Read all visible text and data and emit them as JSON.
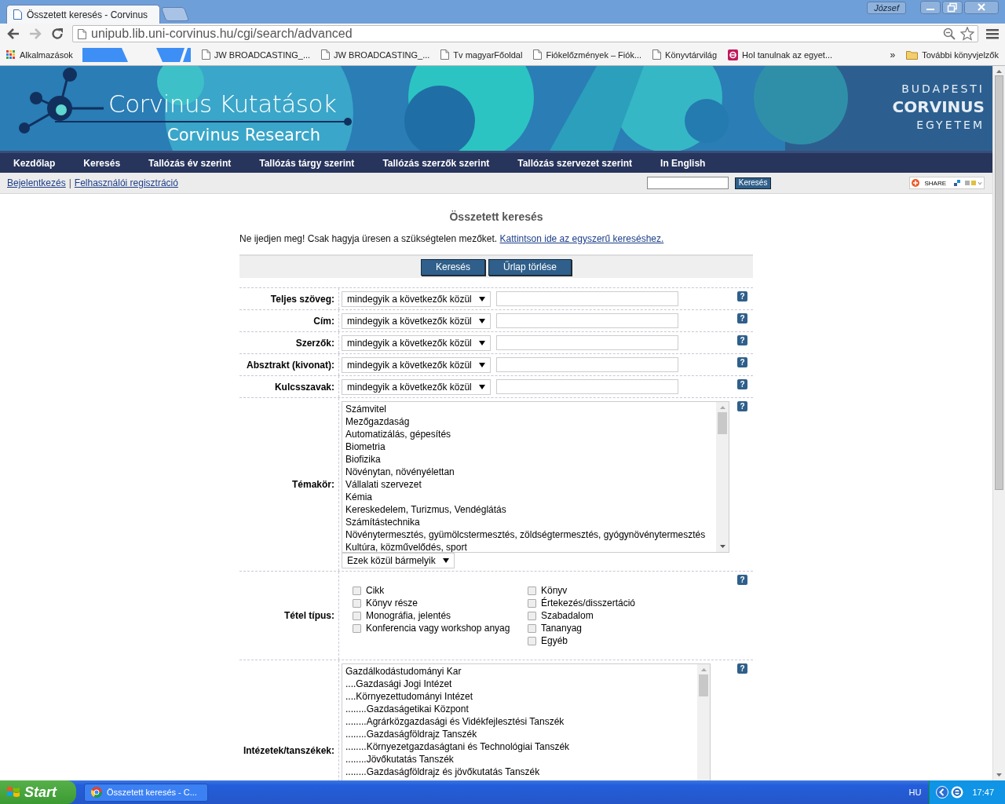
{
  "browser": {
    "tabs": [
      {
        "title": "Összetett keresés - Corvinus",
        "selected": true
      }
    ],
    "user": "József",
    "url": "unipub.lib.uni-corvinus.hu/cgi/search/advanced",
    "bookmarks": [
      {
        "kind": "apps",
        "label": "Alkalmazások"
      },
      {
        "kind": "redacted"
      },
      {
        "kind": "page",
        "label": "JW BROADCASTING_..."
      },
      {
        "kind": "page",
        "label": "JW BROADCASTING_..."
      },
      {
        "kind": "page",
        "label": "Tv magyarFőoldal"
      },
      {
        "kind": "page",
        "label": "Fiókelőzmények – Fiók..."
      },
      {
        "kind": "page",
        "label": "Könyvtárvilág"
      },
      {
        "kind": "edu",
        "label": "Hol tanulnak az egyet..."
      }
    ],
    "more": "»",
    "other_bookmarks": "További könyvjelzők"
  },
  "site": {
    "title": "Corvinus Kutatások",
    "subtitle": "Corvinus Research",
    "logo": [
      "BUDAPESTI",
      "CORVINUS",
      "EGYETEM"
    ],
    "nav": [
      "Kezdőlap",
      "Keresés",
      "Tallózás év szerint",
      "Tallózás tárgy szerint",
      "Tallózás szerzők szerint",
      "Tallózás szervezet szerint",
      "In English"
    ],
    "login": "Bejelentkezés",
    "separator": "|",
    "register": "Felhasználói regisztráció",
    "search_button": "Keresés",
    "share": "SHARE"
  },
  "form": {
    "heading": "Összetett keresés",
    "intro": "Ne ijedjen meg! Csak hagyja üresen a szükségtelen mezőket.",
    "intro_link": "Kattintson ide az egyszerű kereséshez.",
    "buttons": [
      "Keresés",
      "Űrlap törlése"
    ],
    "fields": [
      {
        "label": "Teljes szöveg:",
        "match": "mindegyik a következők közül",
        "help": "?"
      },
      {
        "label": "Cím:",
        "match": "mindegyik a következők közül",
        "help": "?"
      },
      {
        "label": "Szerzők:",
        "match": "mindegyik a következők közül",
        "help": "?"
      },
      {
        "label": "Absztrakt (kivonat):",
        "match": "mindegyik a következők közül",
        "help": "?"
      },
      {
        "label": "Kulcsszavak:",
        "match": "mindegyik a következők közül",
        "help": "?"
      }
    ],
    "topics": {
      "label": "Témakör:",
      "help": "?",
      "mode": "Ezek közül bármelyik",
      "options": [
        "Számvitel",
        "Mezőgazdaság",
        "Automatizálás, gépesítés",
        "Biometria",
        "Biofizika",
        "Növénytan, növényélettan",
        "Vállalati szervezet",
        "Kémia",
        "Kereskedelem, Turizmus, Vendéglátás",
        "Számítástechnika",
        "Növénytermesztés, gyümölcstermesztés, zöldségtermesztés, gyógynövénytermesztés",
        "Kultúra, közművelődés, sport"
      ]
    },
    "item_type": {
      "label": "Tétel típus:",
      "help": "?",
      "columns": [
        [
          {
            "label": "Cikk",
            "checked": false
          },
          {
            "label": "Könyv része",
            "checked": false
          },
          {
            "label": "Monográfia, jelentés",
            "checked": false
          },
          {
            "label": "Konferencia vagy workshop anyag",
            "checked": false
          }
        ],
        [
          {
            "label": "Könyv",
            "checked": false
          },
          {
            "label": "Értekezés/disszertáció",
            "checked": false
          },
          {
            "label": "Szabadalom",
            "checked": false
          },
          {
            "label": "Tananyag",
            "checked": false
          },
          {
            "label": "Egyéb",
            "checked": false
          }
        ]
      ]
    },
    "institutes": {
      "label": "Intézetek/tanszékek:",
      "help": "?",
      "options": [
        "Gazdálkodástudományi Kar",
        "....Gazdasági Jogi Intézet",
        "....Környezettudományi Intézet",
        "........Gazdaságetikai Központ",
        "........Agrárközgazdasági és Vidékfejlesztési Tanszék",
        "........Gazdaságföldrajz Tanszék",
        "........Környezetgazdaságtani és Technológiai Tanszék",
        "........Jövőkutatás Tanszék",
        "........Gazdaságföldrajz és jövőkutatás Tanszék"
      ]
    }
  },
  "taskbar": {
    "start": "Start",
    "task": "Összetett keresés - C...",
    "language": "HU",
    "clock": "17:47"
  }
}
